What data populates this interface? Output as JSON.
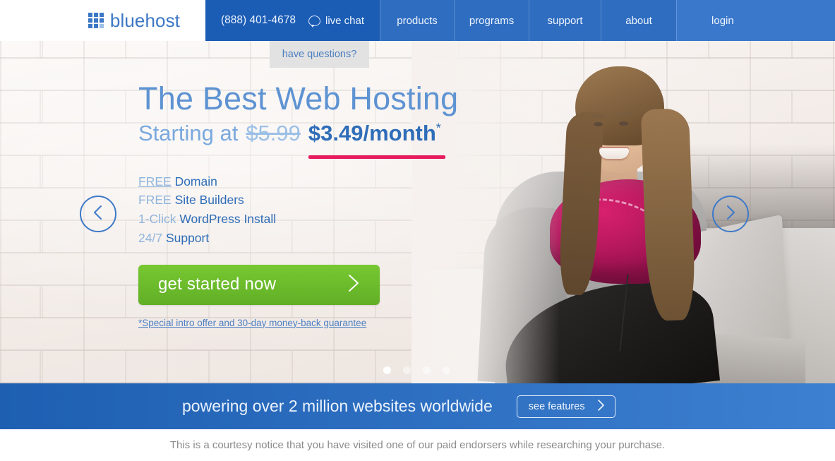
{
  "brand": {
    "name": "bluehost",
    "icon": "grid-logo-icon"
  },
  "nav": {
    "phone": "(888) 401-4678",
    "chat_label": "live chat",
    "chat_icon": "speech-bubble-icon",
    "items": [
      {
        "label": "products"
      },
      {
        "label": "programs"
      },
      {
        "label": "support"
      },
      {
        "label": "about"
      },
      {
        "label": "login"
      }
    ]
  },
  "tooltip": {
    "text": "have questions?"
  },
  "hero": {
    "headline": "The Best Web Hosting",
    "starting_at": "Starting at",
    "old_price": "$5.99",
    "new_price": "$3.49/month",
    "asterisk": "*",
    "features": [
      {
        "key": "FREE",
        "rest": "Domain",
        "underlined": true
      },
      {
        "key": "FREE",
        "rest": "Site Builders",
        "underlined": false
      },
      {
        "key": "1-Click",
        "rest": "WordPress Install",
        "underlined": false
      },
      {
        "key": "24/7",
        "rest": "Support",
        "underlined": false
      }
    ],
    "cta_label": "get started now",
    "cta_icon": "chevron-right-icon",
    "fineprint": "*Special intro offer and 30-day money-back guarantee",
    "prev_icon": "chevron-left-icon",
    "next_icon": "chevron-right-icon",
    "slides": {
      "count": 4,
      "active": 1
    }
  },
  "strip": {
    "text": "powering over 2 million websites worldwide",
    "button_label": "see features",
    "button_icon": "chevron-right-icon"
  },
  "notice": {
    "text": "This is a courtesy notice that you have visited one of our paid endorsers while researching your purchase."
  },
  "colors": {
    "nav_dark_blue": "#1b5cb4",
    "nav_blue": "#2f6dc0",
    "nav_light_blue": "#3a78cb",
    "brand_blue": "#3b77c4",
    "headline_blue": "#5e93d2",
    "price_blue": "#2f6db8",
    "accent_pink": "#e61a5c",
    "cta_green": "#6ab92b",
    "strip_blue": "#2a6bbd"
  }
}
